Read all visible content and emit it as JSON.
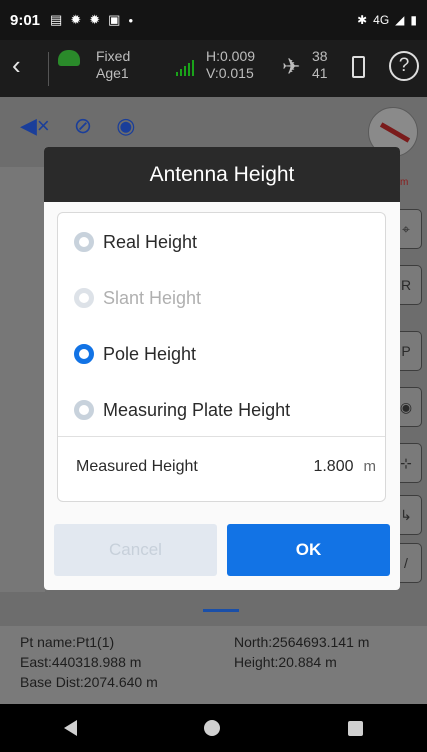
{
  "status_bar": {
    "time": "9:01",
    "icons": [
      "message-icon",
      "settings-icon",
      "settings-icon",
      "photo-icon",
      "dot-icon"
    ],
    "right_icons": [
      "bluetooth-icon",
      "volte-icon",
      "signal-icon",
      "battery-icon"
    ],
    "network_label": "4G"
  },
  "app_header": {
    "fix_status": "Fixed",
    "age_label": "Age1",
    "h_precision": "H:0.009",
    "v_precision": "V:0.015",
    "sat_used": "38",
    "sat_total": "41"
  },
  "toolbar": {
    "icons": [
      "mute-icon",
      "visibility-off-icon",
      "compass-icon"
    ]
  },
  "map": {
    "scale_label": "km",
    "side_buttons": [
      "⌖",
      "R",
      "P",
      "◉",
      "⊹",
      "↳",
      "/"
    ]
  },
  "dialog": {
    "title": "Antenna Height",
    "options": [
      {
        "label": "Real Height",
        "selected": false,
        "enabled": true
      },
      {
        "label": "Slant Height",
        "selected": false,
        "enabled": false
      },
      {
        "label": "Pole Height",
        "selected": true,
        "enabled": true
      },
      {
        "label": "Measuring Plate Height",
        "selected": false,
        "enabled": true
      }
    ],
    "measured_height_label": "Measured Height",
    "measured_height_value": "1.800",
    "measured_height_unit": "m",
    "cancel_label": "Cancel",
    "ok_label": "OK"
  },
  "info_panel": {
    "pt_name": "Pt name:Pt1(1)",
    "north": "North:2564693.141 m",
    "east": "East:440318.988 m",
    "height": "Height:20.884 m",
    "base_dist": "Base Dist:2074.640 m"
  },
  "nav_bar": {
    "buttons": [
      "back-icon",
      "home-icon",
      "recents-icon"
    ]
  }
}
